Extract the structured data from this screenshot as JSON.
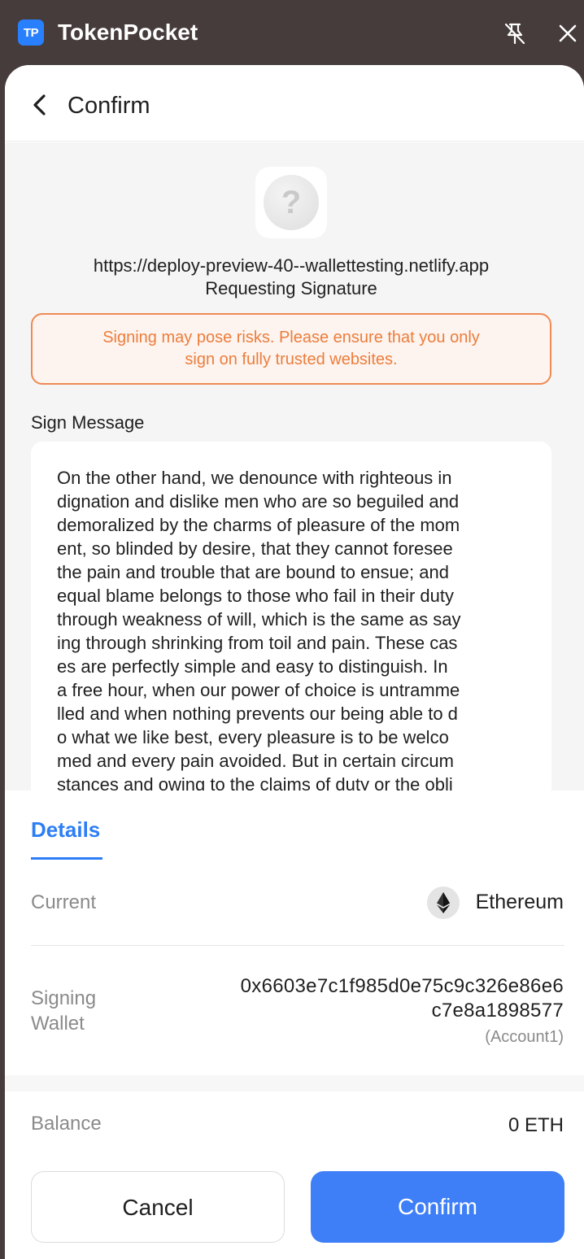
{
  "app": {
    "logo_text": "TP",
    "title": "TokenPocket"
  },
  "header": {
    "title": "Confirm"
  },
  "request": {
    "url": "https://deploy-preview-40--wallettesting.netlify.app",
    "subtitle": "Requesting Signature",
    "site_icon_glyph": "?"
  },
  "warning": {
    "lines": [
      "Signing may pose risks. Please ensure that you only",
      "sign on fully trusted websites."
    ]
  },
  "sign_message": {
    "label": "Sign Message",
    "lines": [
      "On the other hand, we denounce with righteous in",
      "dignation and dislike men who are so beguiled and",
      "demoralized by the charms of pleasure of the mom",
      "ent, so blinded by desire, that they cannot foresee",
      "the pain and trouble that are bound to ensue; and",
      "equal blame belongs to those who fail in their duty",
      "through weakness of will, which is the same as say",
      "ing through shrinking from toil and pain. These cas",
      "es are perfectly simple and easy to distinguish. In",
      "a free hour, when our power of choice is untramme",
      "lled and when nothing prevents our being able to d",
      "o what we like best, every pleasure is to be welco",
      "med and every pain avoided. But in certain circum",
      "stances and owing to the claims of duty or the obli"
    ]
  },
  "details": {
    "tab_label": "Details",
    "current_label": "Current",
    "network": "Ethereum",
    "signing_wallet_label": [
      "Signing",
      "Wallet"
    ],
    "address_lines": [
      "0x6603e7c1f985d0e75c9c326e86e6",
      "c7e8a1898577"
    ],
    "account_name": "(Account1)",
    "balance_label": "Balance",
    "balance_value": "0 ETH"
  },
  "buttons": {
    "cancel": "Cancel",
    "confirm": "Confirm"
  },
  "colors": {
    "accent": "#3e7ef7",
    "warning": "#ec7d3c",
    "titlebar": "#473c3c"
  }
}
